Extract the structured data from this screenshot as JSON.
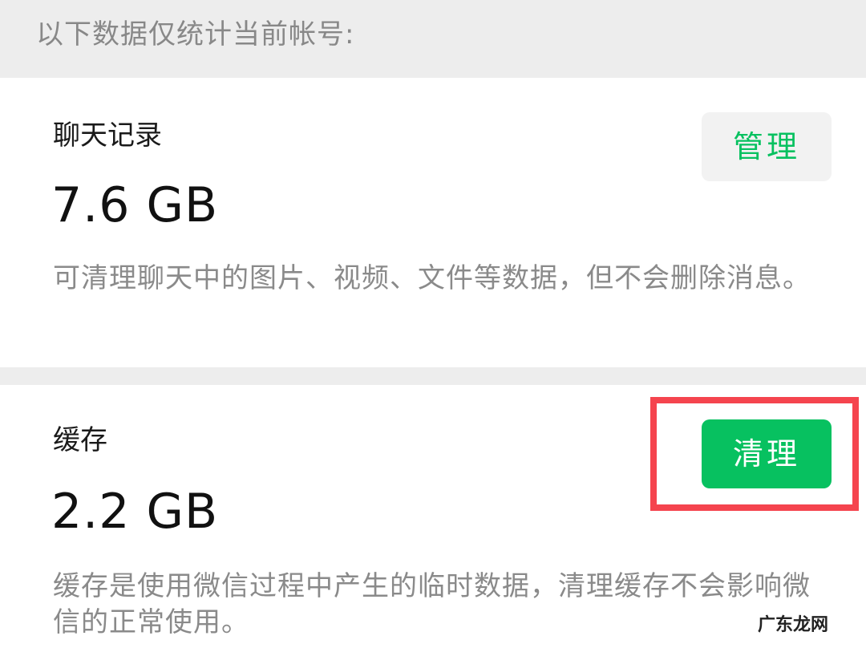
{
  "header": {
    "note": "以下数据仅统计当前帐号:"
  },
  "chat_history": {
    "title": "聊天记录",
    "size": "7.6 GB",
    "description": "可清理聊天中的图片、视频、文件等数据，但不会删除消息。",
    "button_label": "管理"
  },
  "cache": {
    "title": "缓存",
    "size": "2.2 GB",
    "description": "缓存是使用微信过程中产生的临时数据，清理缓存不会影响微信的正常使用。",
    "button_label": "清理"
  },
  "watermark": {
    "text": "广东龙网"
  },
  "colors": {
    "accent_green": "#07c160",
    "highlight_red": "#f5444e",
    "background_gray": "#ededed"
  }
}
